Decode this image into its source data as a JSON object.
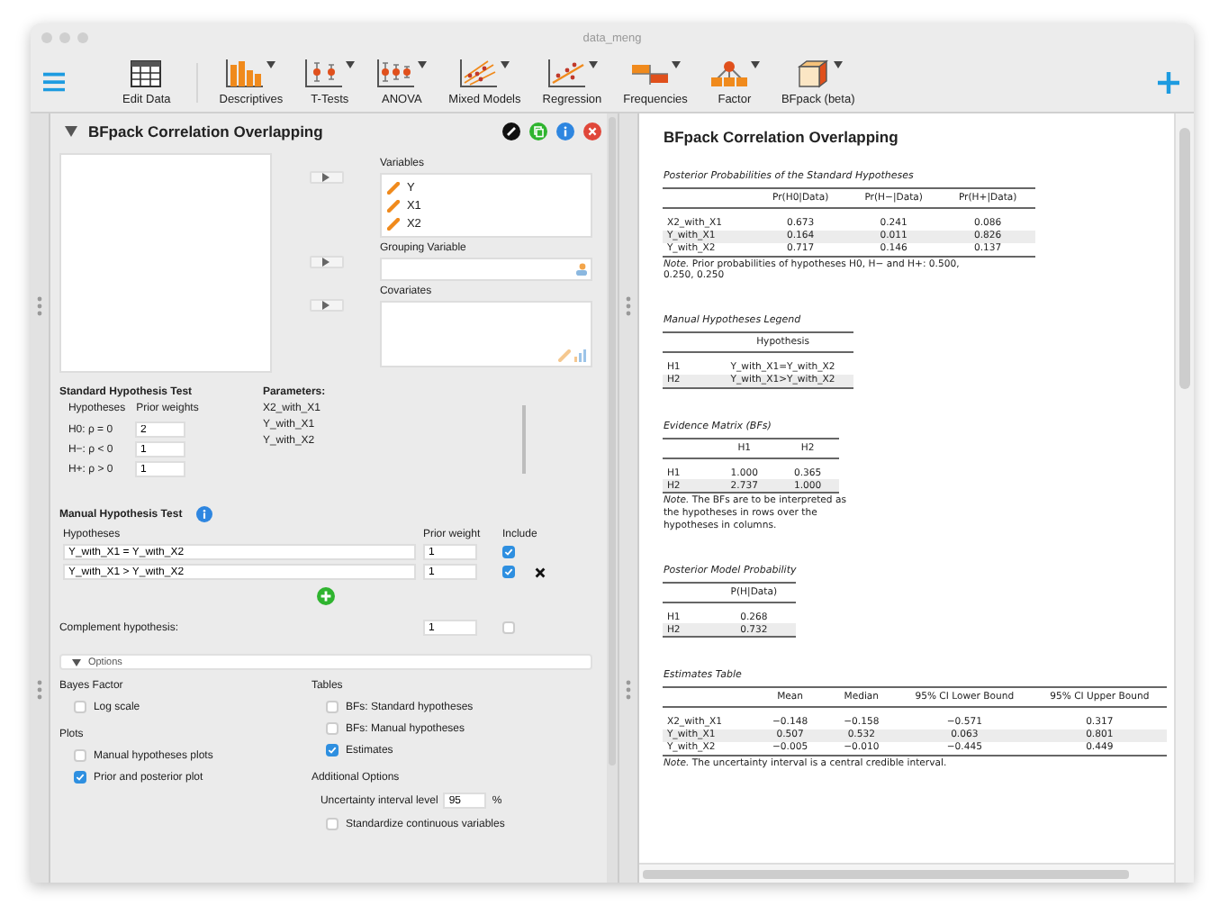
{
  "window": {
    "title": "data_meng"
  },
  "toolbar": {
    "items": [
      {
        "label": "Edit Data",
        "kind": "table",
        "dropdown": false
      },
      {
        "label": "Descriptives",
        "kind": "bars",
        "dropdown": true
      },
      {
        "label": "T-Tests",
        "kind": "ttest",
        "dropdown": true
      },
      {
        "label": "ANOVA",
        "kind": "anova",
        "dropdown": true
      },
      {
        "label": "Mixed Models",
        "kind": "mixed",
        "dropdown": true
      },
      {
        "label": "Regression",
        "kind": "regression",
        "dropdown": true
      },
      {
        "label": "Frequencies",
        "kind": "frequencies",
        "dropdown": true
      },
      {
        "label": "Factor",
        "kind": "factor",
        "dropdown": true
      },
      {
        "label": "BFpack (beta)",
        "kind": "cube",
        "dropdown": true
      }
    ]
  },
  "analysis": {
    "title": "BFpack Correlation Overlapping",
    "expanded": true,
    "variables": {
      "label": "Variables",
      "items": [
        "Y",
        "X1",
        "X2"
      ]
    },
    "grouping": {
      "label": "Grouping Variable"
    },
    "covariates": {
      "label": "Covariates"
    },
    "standard": {
      "title": "Standard Hypothesis Test",
      "columns": [
        "Hypotheses",
        "Prior weights"
      ],
      "rows": [
        {
          "label": "H0: ρ = 0",
          "value": "2"
        },
        {
          "label": "H−: ρ < 0",
          "value": "1"
        },
        {
          "label": "H+: ρ > 0",
          "value": "1"
        }
      ],
      "parameters_title": "Parameters:",
      "parameters": [
        "X2_with_X1",
        "Y_with_X1",
        "Y_with_X2"
      ]
    },
    "manual": {
      "title": "Manual Hypothesis Test",
      "columns": [
        "Hypotheses",
        "Prior weight",
        "Include"
      ],
      "rows": [
        {
          "hypothesis": "Y_with_X1 = Y_with_X2",
          "weight": "1",
          "checked": true,
          "removable": false
        },
        {
          "hypothesis": "Y_with_X1 > Y_with_X2",
          "weight": "1",
          "checked": true,
          "removable": true
        }
      ],
      "complement": {
        "label": "Complement hypothesis:",
        "weight": "1",
        "checked": false
      }
    },
    "options": {
      "label": "Options",
      "expanded": true,
      "left": [
        {
          "title": "Bayes Factor",
          "items": [
            {
              "kind": "checkbox",
              "label": "Log scale",
              "checked": false
            }
          ]
        },
        {
          "title": "Plots",
          "items": [
            {
              "kind": "checkbox",
              "label": "Manual hypotheses plots",
              "checked": false
            },
            {
              "kind": "checkbox",
              "label": "Prior and posterior plot",
              "checked": true
            }
          ]
        }
      ],
      "right": [
        {
          "title": "Tables",
          "items": [
            {
              "kind": "checkbox",
              "label": "BFs: Standard hypotheses",
              "checked": false
            },
            {
              "kind": "checkbox",
              "label": "BFs: Manual hypotheses",
              "checked": false
            },
            {
              "kind": "checkbox",
              "label": "Estimates",
              "checked": true
            }
          ]
        },
        {
          "title": "Additional Options",
          "items": [
            {
              "kind": "number",
              "label": "Uncertainty interval level",
              "value": "95",
              "unit": "%"
            },
            {
              "kind": "checkbox",
              "label": "Standardize continuous variables",
              "checked": false
            }
          ]
        }
      ]
    }
  },
  "output": {
    "title": "BFpack Correlation Overlapping",
    "tables": [
      {
        "title": "Posterior Probabilities of the Standard Hypotheses",
        "columns": [
          "",
          "Pr(H0|Data)",
          "Pr(H−|Data)",
          "Pr(H+|Data)"
        ],
        "rows": [
          [
            "X2_with_X1",
            "0.673",
            "0.241",
            "0.086"
          ],
          [
            "Y_with_X1",
            "0.164",
            "0.011",
            "0.826"
          ],
          [
            "Y_with_X2",
            "0.717",
            "0.146",
            "0.137"
          ]
        ],
        "note": "*Note.* Prior probabilities of hypotheses H0, H− and H+: 0.500, 0.250, 0.250"
      },
      {
        "title": "Manual Hypotheses Legend",
        "columns": [
          "",
          "Hypothesis"
        ],
        "rows": [
          [
            "H1",
            "Y_with_X1=Y_with_X2"
          ],
          [
            "H2",
            "Y_with_X1>Y_with_X2"
          ]
        ]
      },
      {
        "title": "Evidence Matrix (BFs)",
        "columns": [
          "",
          "H1",
          "H2"
        ],
        "rows": [
          [
            "H1",
            "1.000",
            "0.365"
          ],
          [
            "H2",
            "2.737",
            "1.000"
          ]
        ],
        "note": "*Note.* The BFs are to be interpreted as the hypotheses in rows over the hypotheses in columns."
      },
      {
        "title": "Posterior Model Probability",
        "columns": [
          "",
          "P(H|Data)"
        ],
        "rows": [
          [
            "H1",
            "0.268"
          ],
          [
            "H2",
            "0.732"
          ]
        ]
      },
      {
        "title": "Estimates Table",
        "columns": [
          "",
          "Mean",
          "Median",
          "95% CI Lower Bound",
          "95% CI Upper Bound"
        ],
        "rows": [
          [
            "X2_with_X1",
            "−0.148",
            "−0.158",
            "−0.571",
            "0.317"
          ],
          [
            "Y_with_X1",
            "0.507",
            "0.532",
            "0.063",
            "0.801"
          ],
          [
            "Y_with_X2",
            "−0.005",
            "−0.010",
            "−0.445",
            "0.449"
          ]
        ],
        "note": "*Note.* The uncertainty interval is a central credible interval."
      }
    ]
  }
}
